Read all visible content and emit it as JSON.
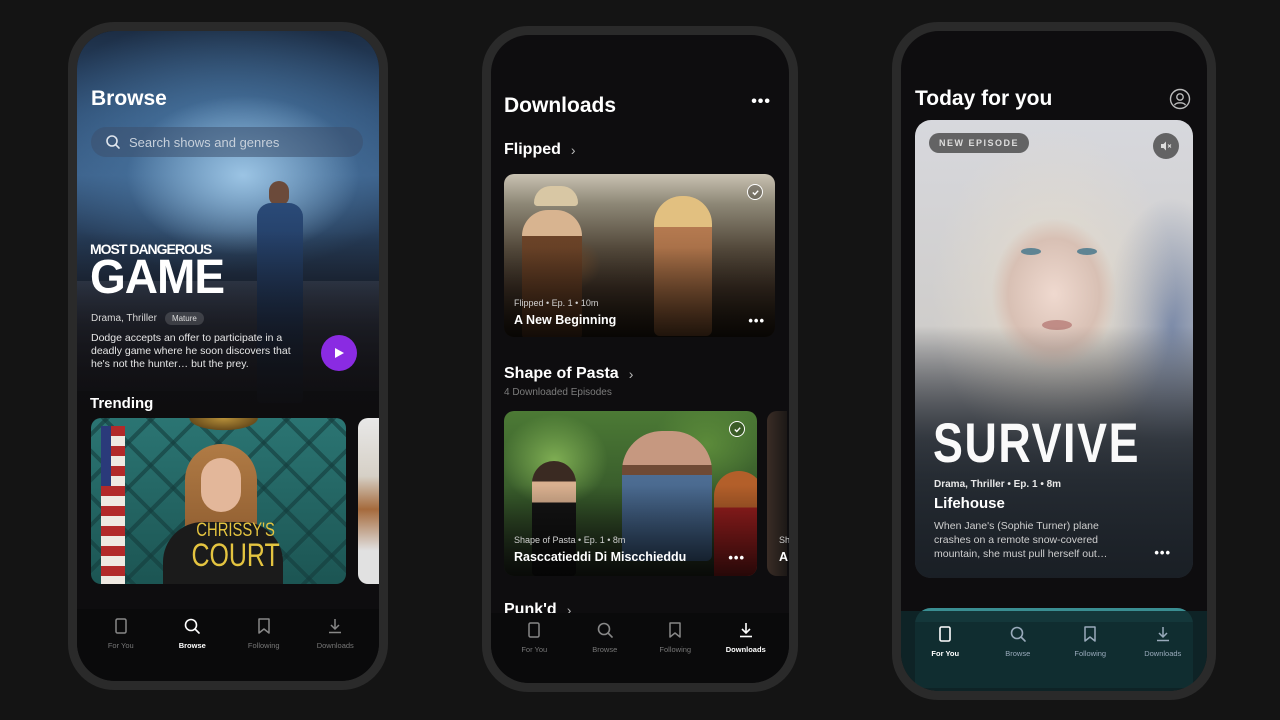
{
  "nav_tabs": [
    "For You",
    "Browse",
    "Following",
    "Downloads"
  ],
  "browse": {
    "title": "Browse",
    "search_placeholder": "Search shows and genres",
    "hero": {
      "logo_line1": "MOST DANGEROUS",
      "logo_line2": "GAME",
      "genres": "Drama, Thriller",
      "rating_badge": "Mature",
      "description": "Dodge accepts an offer to participate in a deadly game where he soon discovers that he's not the hunter… but the prey."
    },
    "trending_title": "Trending",
    "trending": [
      {
        "logo_line1": "CHRISSY'S",
        "logo_line2": "COURT"
      },
      {
        "logo_line1": "",
        "logo_line2": ""
      }
    ],
    "active_tab": "Browse"
  },
  "downloads": {
    "title": "Downloads",
    "more": "•••",
    "groups": [
      {
        "title": "Flipped",
        "subtitle": "",
        "episodes": [
          {
            "meta": "Flipped • Ep. 1 • 10m",
            "name": "A New Beginning",
            "downloaded": true
          }
        ]
      },
      {
        "title": "Shape of Pasta",
        "subtitle": "4 Downloaded Episodes",
        "episodes": [
          {
            "meta": "Shape of Pasta • Ep. 1 • 8m",
            "name": "Rasccatieddi Di Miscchieddu",
            "downloaded": true
          },
          {
            "meta": "Sh",
            "name": "A",
            "downloaded": true
          }
        ]
      },
      {
        "title": "Punk'd",
        "subtitle": "",
        "episodes": []
      }
    ],
    "active_tab": "Downloads"
  },
  "today": {
    "title": "Today for you",
    "feature": {
      "badge": "NEW EPISODE",
      "logo": "SURVIVE",
      "meta": "Drama, Thriller  •  Ep. 1  •  8m",
      "episode_name": "Lifehouse",
      "description": "When Jane's (Sophie Turner) plane crashes on a remote snow-covered mountain, she must pull herself out…",
      "more": "•••",
      "muted": true
    },
    "active_tab": "For You"
  },
  "colors": {
    "accent_purple": "#8a2be2",
    "background": "#141414",
    "screen": "#0e0d0f",
    "court_gold": "#e4c440"
  }
}
